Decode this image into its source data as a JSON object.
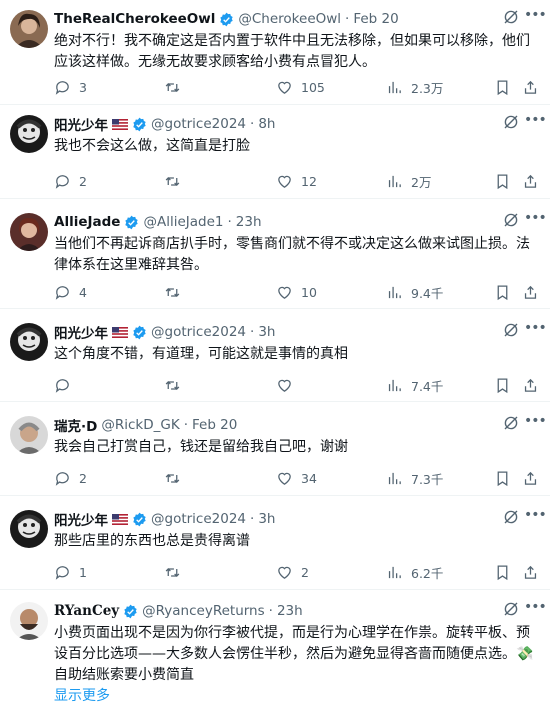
{
  "tweets": [
    {
      "name": "TheRealCherokeeOwl",
      "handle": "@CherokeeOwl",
      "time": "Feb 20",
      "text": "绝对不行！我不确定这是否内置于软件中且无法移除，但如果可以移除，他们应该这样做。无缘无故要求顾客给小费有点冒犯人。",
      "replies": "3",
      "retweets": "",
      "likes": "105",
      "views": "2.3万"
    },
    {
      "name": "阳光少年",
      "handle": "@gotrice2024",
      "time": "8h",
      "text": "我也不会这么做，这简直是打脸",
      "replies": "2",
      "retweets": "",
      "likes": "12",
      "views": "2万"
    },
    {
      "name": "AllieJade",
      "handle": "@AllieJade1",
      "time": "23h",
      "text": "当他们不再起诉商店扒手时，零售商们就不得不或决定这么做来试图止损。法律体系在这里难辞其咎。",
      "replies": "4",
      "retweets": "",
      "likes": "10",
      "views": "9.4千"
    },
    {
      "name": "阳光少年",
      "handle": "@gotrice2024",
      "time": "3h",
      "text": "这个角度不错，有道理，可能这就是事情的真相",
      "replies": "",
      "retweets": "",
      "likes": "",
      "views": "7.4千"
    },
    {
      "name": "瑞克·D",
      "handle": "@RickD_GK",
      "time": "Feb 20",
      "text": "我会自己打赏自己，钱还是留给我自己吧，谢谢",
      "replies": "2",
      "retweets": "",
      "likes": "34",
      "views": "7.3千"
    },
    {
      "name": "阳光少年",
      "handle": "@gotrice2024",
      "time": "3h",
      "text": "那些店里的东西也总是贵得离谱",
      "replies": "1",
      "retweets": "",
      "likes": "2",
      "views": "6.2千"
    },
    {
      "name": "RYanCey",
      "handle": "@RyanceyReturns",
      "time": "23h",
      "text": "小费页面出现不是因为你行李被代提，而是行为心理学在作祟。旋转平板、预设百分比选项——大多数人会愣住半秒，然后为避免显得吝啬而随便点选。💸 自助结账索要小费简直",
      "show_more": "显示更多"
    }
  ],
  "separator": "·",
  "colors": {
    "accent": "#1d9bf0",
    "muted": "#536471",
    "text": "#0f1419",
    "verified": "#1d9bf0"
  },
  "icons": [
    "reply-icon",
    "retweet-icon",
    "like-icon",
    "views-icon",
    "bookmark-icon",
    "share-icon",
    "grok-icon",
    "more-icon",
    "verified-icon",
    "us-flag-icon"
  ]
}
